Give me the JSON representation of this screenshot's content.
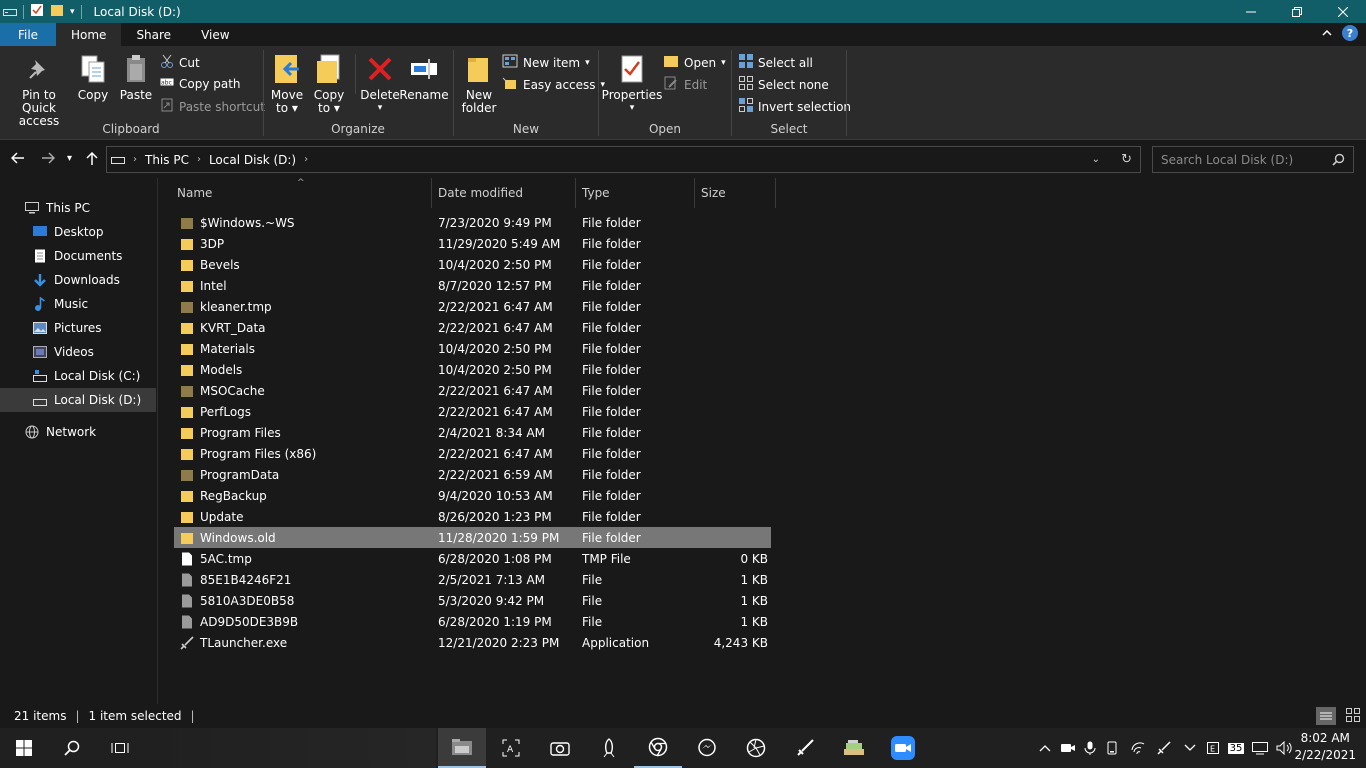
{
  "window": {
    "title": "Local Disk (D:)"
  },
  "tabs": [
    "File",
    "Home",
    "Share",
    "View"
  ],
  "ribbon": {
    "clipboard": {
      "label": "Clipboard",
      "pin_line1": "Pin to Quick",
      "pin_line2": "access",
      "copy": "Copy",
      "paste": "Paste",
      "cut": "Cut",
      "copy_path": "Copy path",
      "paste_shortcut": "Paste shortcut"
    },
    "organize": {
      "label": "Organize",
      "move_line1": "Move",
      "move_line2": "to",
      "copy_line1": "Copy",
      "copy_line2": "to",
      "delete": "Delete",
      "rename": "Rename"
    },
    "new": {
      "label": "New",
      "folder_line1": "New",
      "folder_line2": "folder",
      "new_item": "New item",
      "easy_access": "Easy access"
    },
    "open": {
      "label": "Open",
      "properties": "Properties",
      "open": "Open",
      "edit": "Edit"
    },
    "select": {
      "label": "Select",
      "select_all": "Select all",
      "select_none": "Select none",
      "invert": "Invert selection"
    }
  },
  "address": {
    "crumbs": [
      "This PC",
      "Local Disk (D:)"
    ],
    "search_placeholder": "Search Local Disk (D:)"
  },
  "nav": [
    {
      "label": "This PC",
      "icon": "pc-icon"
    },
    {
      "label": "Desktop",
      "icon": "desktop-icon"
    },
    {
      "label": "Documents",
      "icon": "documents-icon"
    },
    {
      "label": "Downloads",
      "icon": "downloads-icon"
    },
    {
      "label": "Music",
      "icon": "music-icon"
    },
    {
      "label": "Pictures",
      "icon": "pictures-icon"
    },
    {
      "label": "Videos",
      "icon": "videos-icon"
    },
    {
      "label": "Local Disk (C:)",
      "icon": "drive-icon"
    },
    {
      "label": "Local Disk (D:)",
      "icon": "drive-icon"
    },
    {
      "label": "Network",
      "icon": "network-icon"
    }
  ],
  "columns": [
    "Name",
    "Date modified",
    "Type",
    "Size"
  ],
  "files": [
    {
      "name": "$Windows.~WS",
      "date": "7/23/2020 9:49 PM",
      "type": "File folder",
      "size": "",
      "icon": "folder-dim"
    },
    {
      "name": "3DP",
      "date": "11/29/2020 5:49 AM",
      "type": "File folder",
      "size": "",
      "icon": "folder"
    },
    {
      "name": "Bevels",
      "date": "10/4/2020 2:50 PM",
      "type": "File folder",
      "size": "",
      "icon": "folder"
    },
    {
      "name": "Intel",
      "date": "8/7/2020 12:57 PM",
      "type": "File folder",
      "size": "",
      "icon": "folder"
    },
    {
      "name": "kleaner.tmp",
      "date": "2/22/2021 6:47 AM",
      "type": "File folder",
      "size": "",
      "icon": "folder-dim"
    },
    {
      "name": "KVRT_Data",
      "date": "2/22/2021 6:47 AM",
      "type": "File folder",
      "size": "",
      "icon": "folder"
    },
    {
      "name": "Materials",
      "date": "10/4/2020 2:50 PM",
      "type": "File folder",
      "size": "",
      "icon": "folder"
    },
    {
      "name": "Models",
      "date": "10/4/2020 2:50 PM",
      "type": "File folder",
      "size": "",
      "icon": "folder"
    },
    {
      "name": "MSOCache",
      "date": "2/22/2021 6:47 AM",
      "type": "File folder",
      "size": "",
      "icon": "folder-dim"
    },
    {
      "name": "PerfLogs",
      "date": "2/22/2021 6:47 AM",
      "type": "File folder",
      "size": "",
      "icon": "folder"
    },
    {
      "name": "Program Files",
      "date": "2/4/2021 8:34 AM",
      "type": "File folder",
      "size": "",
      "icon": "folder"
    },
    {
      "name": "Program Files (x86)",
      "date": "2/22/2021 6:47 AM",
      "type": "File folder",
      "size": "",
      "icon": "folder"
    },
    {
      "name": "ProgramData",
      "date": "2/22/2021 6:59 AM",
      "type": "File folder",
      "size": "",
      "icon": "folder-dim"
    },
    {
      "name": "RegBackup",
      "date": "9/4/2020 10:53 AM",
      "type": "File folder",
      "size": "",
      "icon": "folder"
    },
    {
      "name": "Update",
      "date": "8/26/2020 1:23 PM",
      "type": "File folder",
      "size": "",
      "icon": "folder"
    },
    {
      "name": "Windows.old",
      "date": "11/28/2020 1:59 PM",
      "type": "File folder",
      "size": "",
      "icon": "folder",
      "selected": true
    },
    {
      "name": "5AC.tmp",
      "date": "6/28/2020 1:08 PM",
      "type": "TMP File",
      "size": "0 KB",
      "icon": "file-white"
    },
    {
      "name": "85E1B4246F21",
      "date": "2/5/2021 7:13 AM",
      "type": "File",
      "size": "1 KB",
      "icon": "file-grey"
    },
    {
      "name": "5810A3DE0B58",
      "date": "5/3/2020 9:42 PM",
      "type": "File",
      "size": "1 KB",
      "icon": "file-grey"
    },
    {
      "name": "AD9D50DE3B9B",
      "date": "6/28/2020 1:19 PM",
      "type": "File",
      "size": "1 KB",
      "icon": "file-grey"
    },
    {
      "name": "TLauncher.exe",
      "date": "12/21/2020 2:23 PM",
      "type": "Application",
      "size": "4,243 KB",
      "icon": "app-icon"
    }
  ],
  "status": {
    "count": "21 items",
    "selected": "1 item selected"
  },
  "taskbar": {
    "tray_badge": "35",
    "time": "8:02 AM",
    "date": "2/22/2021"
  },
  "colors": {
    "titlebar": "#115e69",
    "file_tab": "#1a6fa8",
    "folder": "#f5cc5a",
    "folder_dim": "#8f7a4a",
    "selection": "#777777"
  }
}
